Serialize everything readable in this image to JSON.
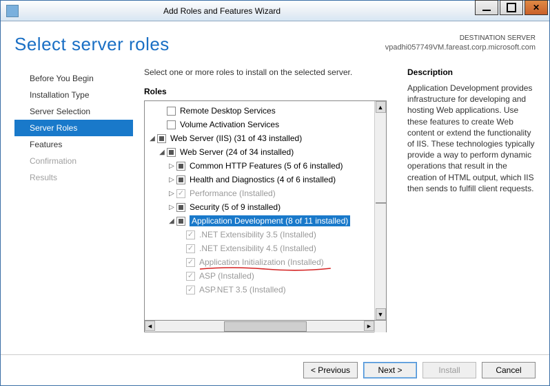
{
  "window": {
    "title": "Add Roles and Features Wizard"
  },
  "header": {
    "page_title": "Select server roles",
    "destination_label": "DESTINATION SERVER",
    "destination_value": "vpadhi057749VM.fareast.corp.microsoft.com"
  },
  "sidebar": {
    "items": [
      {
        "label": "Before You Begin",
        "state": "normal"
      },
      {
        "label": "Installation Type",
        "state": "normal"
      },
      {
        "label": "Server Selection",
        "state": "normal"
      },
      {
        "label": "Server Roles",
        "state": "selected"
      },
      {
        "label": "Features",
        "state": "normal"
      },
      {
        "label": "Confirmation",
        "state": "disabled"
      },
      {
        "label": "Results",
        "state": "disabled"
      }
    ]
  },
  "main": {
    "instruction": "Select one or more roles to install on the selected server.",
    "roles_label": "Roles",
    "tree": [
      {
        "indent": 1,
        "expander": "none",
        "check": "empty",
        "label": "Remote Desktop Services"
      },
      {
        "indent": 1,
        "expander": "none",
        "check": "empty",
        "label": "Volume Activation Services"
      },
      {
        "indent": 0,
        "expander": "open",
        "check": "tri",
        "label": "Web Server (IIS) (31 of 43 installed)"
      },
      {
        "indent": 1,
        "expander": "open",
        "check": "tri",
        "label": "Web Server (24 of 34 installed)"
      },
      {
        "indent": 2,
        "expander": "closed",
        "check": "tri",
        "label": "Common HTTP Features (5 of 6 installed)"
      },
      {
        "indent": 2,
        "expander": "closed",
        "check": "tri",
        "label": "Health and Diagnostics (4 of 6 installed)"
      },
      {
        "indent": 2,
        "expander": "closed",
        "check": "checked-dim",
        "label": "Performance (Installed)",
        "dim": true
      },
      {
        "indent": 2,
        "expander": "closed",
        "check": "tri",
        "label": "Security (5 of 9 installed)"
      },
      {
        "indent": 2,
        "expander": "open",
        "check": "tri",
        "label": "Application Development (8 of 11 installed)",
        "selected": true
      },
      {
        "indent": 3,
        "expander": "none",
        "check": "checked-dim",
        "label": ".NET Extensibility 3.5 (Installed)",
        "dim": true
      },
      {
        "indent": 3,
        "expander": "none",
        "check": "checked-dim",
        "label": ".NET Extensibility 4.5 (Installed)",
        "dim": true
      },
      {
        "indent": 3,
        "expander": "none",
        "check": "checked-dim",
        "label": "Application Initialization (Installed)",
        "dim": true,
        "underlined": true
      },
      {
        "indent": 3,
        "expander": "none",
        "check": "checked-dim",
        "label": "ASP (Installed)",
        "dim": true
      },
      {
        "indent": 3,
        "expander": "none",
        "check": "checked-dim",
        "label": "ASP.NET 3.5 (Installed)",
        "dim": true
      }
    ]
  },
  "description": {
    "title": "Description",
    "text": "Application Development provides infrastructure for developing and hosting Web applications. Use these features to create Web content or extend the functionality of IIS. These technologies typically provide a way to perform dynamic operations that result in the creation of HTML output, which IIS then sends to fulfill client requests."
  },
  "footer": {
    "previous": "< Previous",
    "next": "Next >",
    "install": "Install",
    "cancel": "Cancel"
  }
}
